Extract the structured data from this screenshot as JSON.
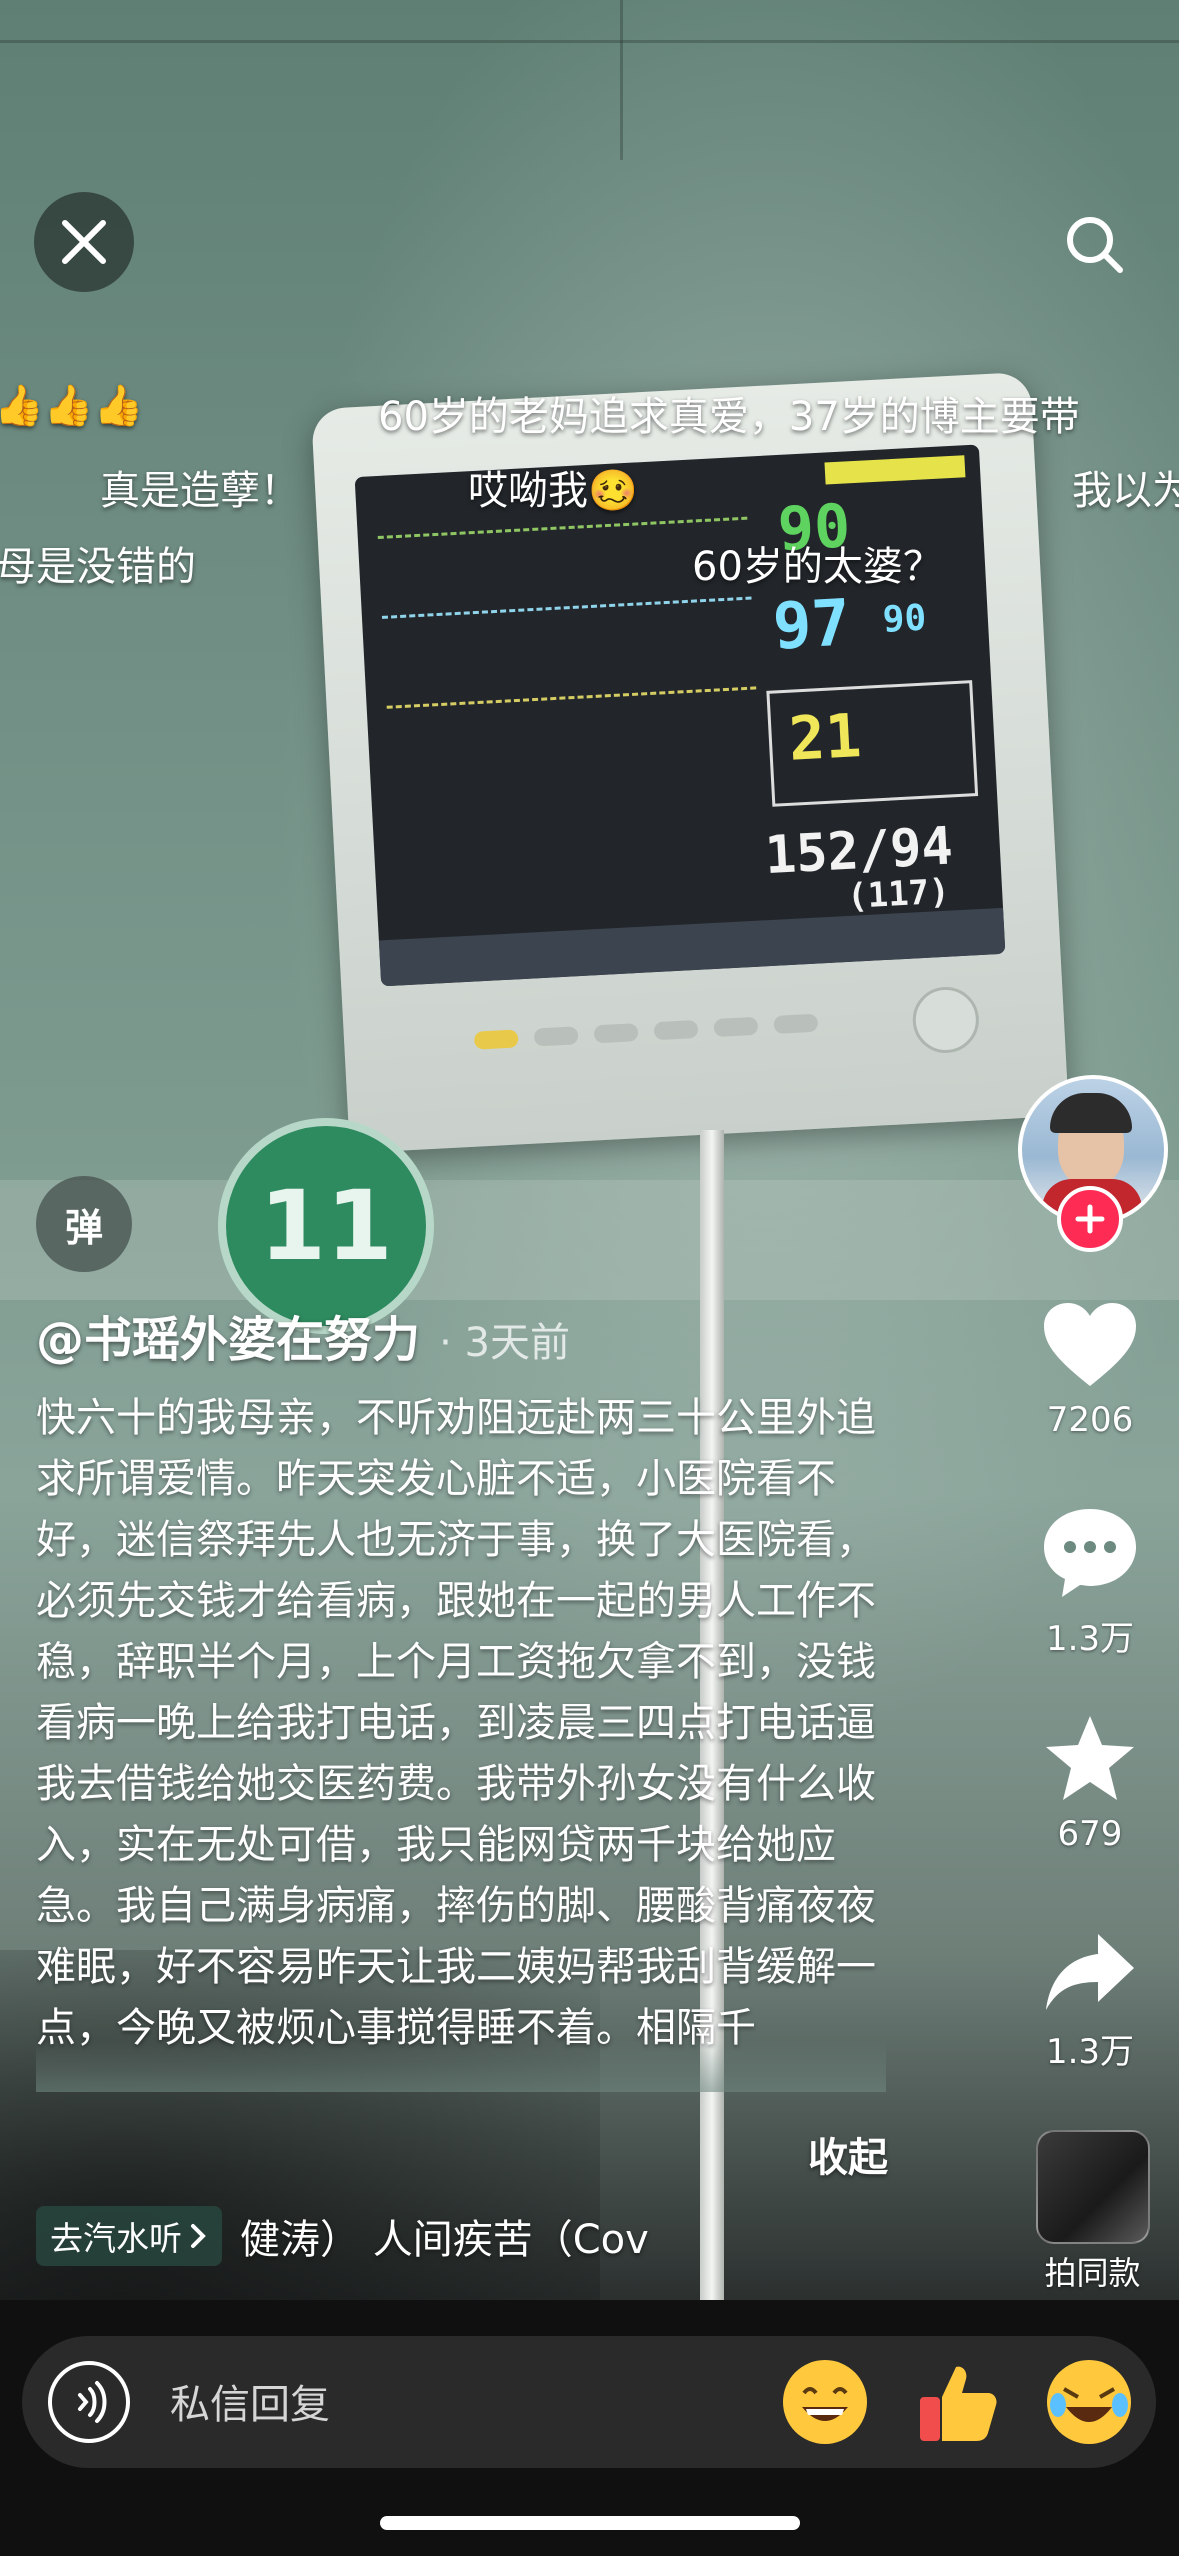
{
  "top": {
    "close_icon": "close-icon",
    "search_icon": "search-icon"
  },
  "danmaku": [
    {
      "text": "👍👍👍"
    },
    {
      "text": "60岁的老妈追求真爱，37岁的博主要带"
    },
    {
      "text": "真是造孽！"
    },
    {
      "text": "哎呦我🥴"
    },
    {
      "text": "我以为"
    },
    {
      "text": "母是没错的"
    },
    {
      "text": "60岁的太婆？"
    }
  ],
  "scene": {
    "bed_number": "11"
  },
  "left": {
    "danmu_toggle_label": "弹",
    "author": "@书瑶外婆在努力",
    "time": "· 3天前",
    "description": "快六十的我母亲，不听劝阻远赴两三十公里外追求所谓爱情。昨天突发心脏不适，小医院看不好，迷信祭拜先人也无济于事，换了大医院看，必须先交钱才给看病，跟她在一起的男人工作不稳，辞职半个月，上个月工资拖欠拿不到，没钱看病一晚上给我打电话，到凌晨三四点打电话逼我去借钱给她交医药费。我带外孙女没有什么收入，实在无处可借，我只能网贷两千块给她应急。我自己满身病痛，摔伤的脚、腰酸背痛夜夜难眠，好不容易昨天让我二姨妈帮我刮背缓解一点，今晚又被烦心事搅得睡不着。相隔千",
    "collapse_label": "收起",
    "music_chip_label": "去汽水听",
    "music_track": "健涛）    人间疾苦（Cov"
  },
  "right": {
    "like_count": "7206",
    "comment_count": "1.3万",
    "favorite_count": "679",
    "share_count": "1.3万",
    "same_style_label": "拍同款"
  },
  "bottom": {
    "reply_placeholder": "私信回复",
    "emojis": [
      "grinning-face-icon",
      "thumbs-up-icon",
      "rofl-face-icon"
    ]
  },
  "colors": {
    "follow_accent": "#fe2c55",
    "bed_badge": "#2e8a5f"
  }
}
